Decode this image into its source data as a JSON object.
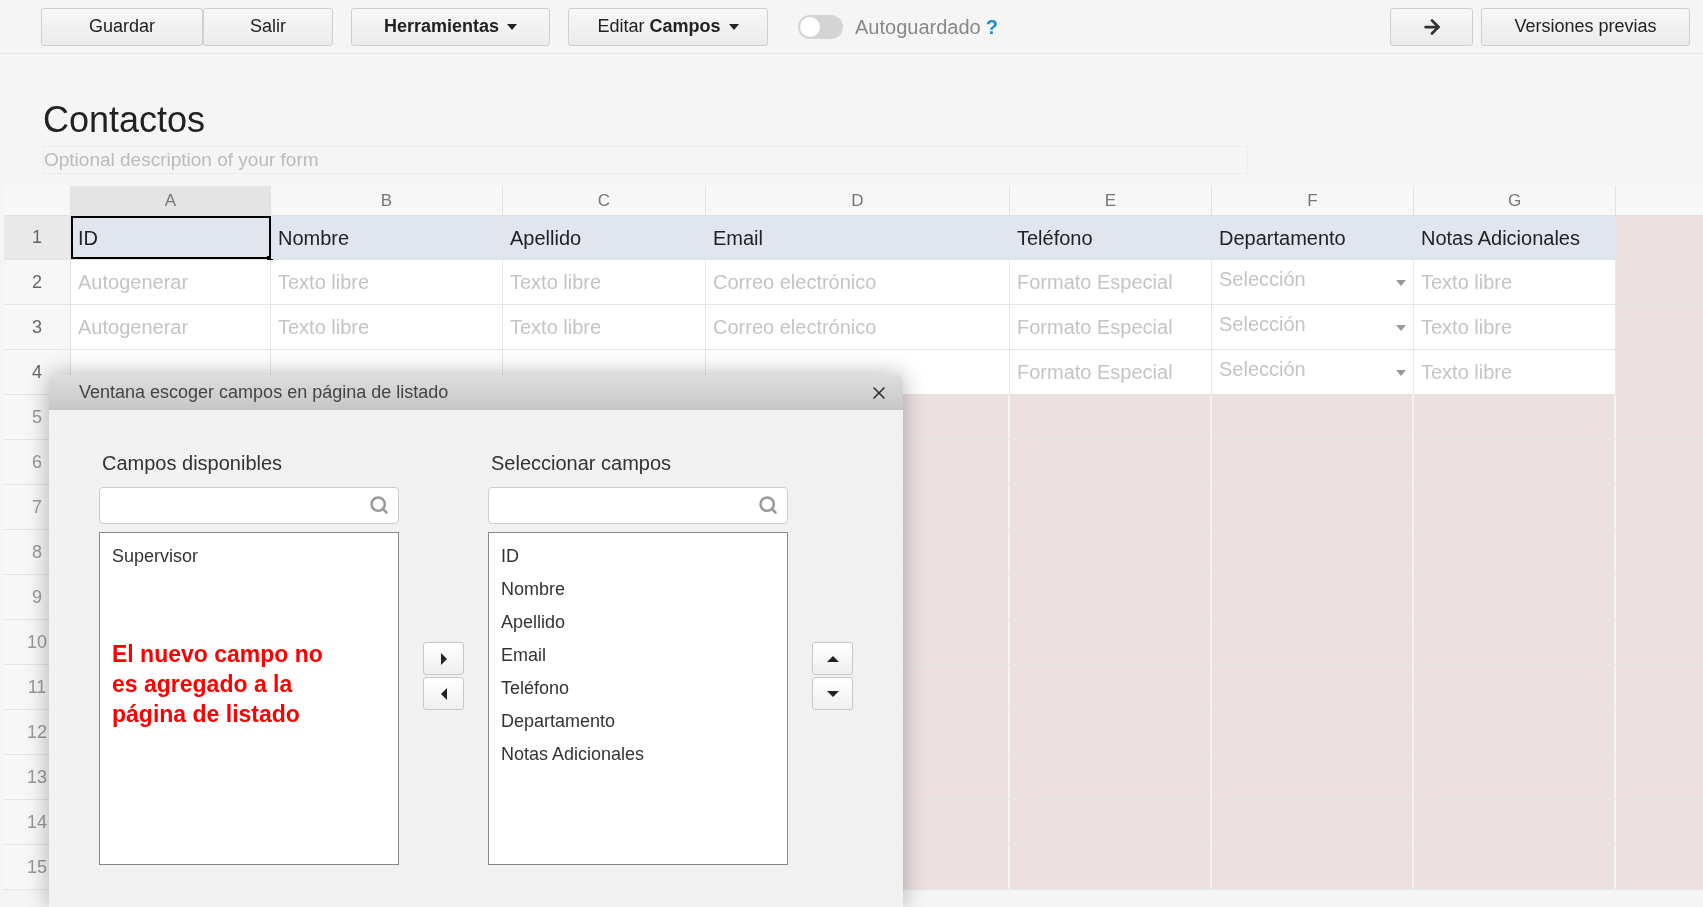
{
  "toolbar": {
    "buttons": [
      {
        "label": "Guardar",
        "kind": "plain",
        "bold": false
      },
      {
        "label": "Salir",
        "kind": "plain",
        "bold": false
      },
      {
        "label": "Herramientas",
        "kind": "dropdown",
        "bold": true
      },
      {
        "label": "Editar **Campos**",
        "kind": "dropdown",
        "bold": false
      }
    ],
    "autosave": {
      "label": "Autoguardado",
      "on": false,
      "help": "?"
    },
    "right_buttons": [
      {
        "kind": "arrow"
      },
      {
        "kind": "text",
        "label": "Versiones previas"
      }
    ]
  },
  "form": {
    "title": "Contactos",
    "description_placeholder": "Optional description of your form"
  },
  "grid": {
    "columns": [
      {
        "letter": "A",
        "selected": true
      },
      {
        "letter": "B",
        "selected": false
      },
      {
        "letter": "C",
        "selected": false
      },
      {
        "letter": "D",
        "selected": false
      },
      {
        "letter": "E",
        "selected": false
      },
      {
        "letter": "F",
        "selected": false
      },
      {
        "letter": "G",
        "selected": false
      }
    ],
    "rows": [
      {
        "number": "1",
        "kind": "header",
        "cells": [
          {
            "text": "ID",
            "selected": true
          },
          {
            "text": "Nombre",
            "selected": false
          },
          {
            "text": "Apellido",
            "selected": false
          },
          {
            "text": "Email",
            "selected": false
          },
          {
            "text": "Teléfono",
            "selected": false
          },
          {
            "text": "Departamento",
            "selected": false
          },
          {
            "text": "Notas Adicionales",
            "selected": false
          }
        ]
      },
      {
        "number": "2",
        "kind": "input",
        "cells": [
          {
            "text": "Autogenerar",
            "selected": false
          },
          {
            "text": "Texto libre",
            "selected": false
          },
          {
            "text": "Texto libre",
            "selected": false
          },
          {
            "text": "Correo electrónico",
            "selected": false
          },
          {
            "text": "Formato Especial",
            "selected": false
          },
          {
            "text": "Selección",
            "kind": "select",
            "selected": false
          },
          {
            "text": "Texto libre",
            "selected": false
          }
        ]
      },
      {
        "number": "3",
        "kind": "input",
        "cells": [
          {
            "text": "Autogenerar",
            "selected": false
          },
          {
            "text": "Texto libre",
            "selected": false
          },
          {
            "text": "Texto libre",
            "selected": false
          },
          {
            "text": "Correo electrónico",
            "selected": false
          },
          {
            "text": "Formato Especial",
            "selected": false
          },
          {
            "text": "Selección",
            "kind": "select",
            "selected": false
          },
          {
            "text": "Texto libre",
            "selected": false
          }
        ]
      },
      {
        "number": "4",
        "kind": "input",
        "cells": [
          {
            "selected": false
          },
          {
            "selected": false
          },
          {
            "selected": false
          },
          {
            "selected": false
          },
          {
            "text": "Formato Especial",
            "selected": false
          },
          {
            "text": "Selección",
            "kind": "select",
            "selected": false
          },
          {
            "text": "Texto libre",
            "selected": false
          }
        ]
      }
    ],
    "empty_rows": [
      "5",
      "6",
      "7",
      "8",
      "9",
      "10",
      "11",
      "12",
      "13",
      "14",
      "15"
    ]
  },
  "dialog": {
    "title": "Ventana escoger campos en página de listado",
    "available": {
      "label": "Campos disponibles",
      "items": [
        "Supervisor"
      ],
      "annotation": "El nuevo campo no es agregado a la página de listado"
    },
    "selected": {
      "label": "Seleccionar campos",
      "items": [
        "ID",
        "Nombre",
        "Apellido",
        "Email",
        "Teléfono",
        "Departamento",
        "Notas Adicionales"
      ]
    }
  }
}
